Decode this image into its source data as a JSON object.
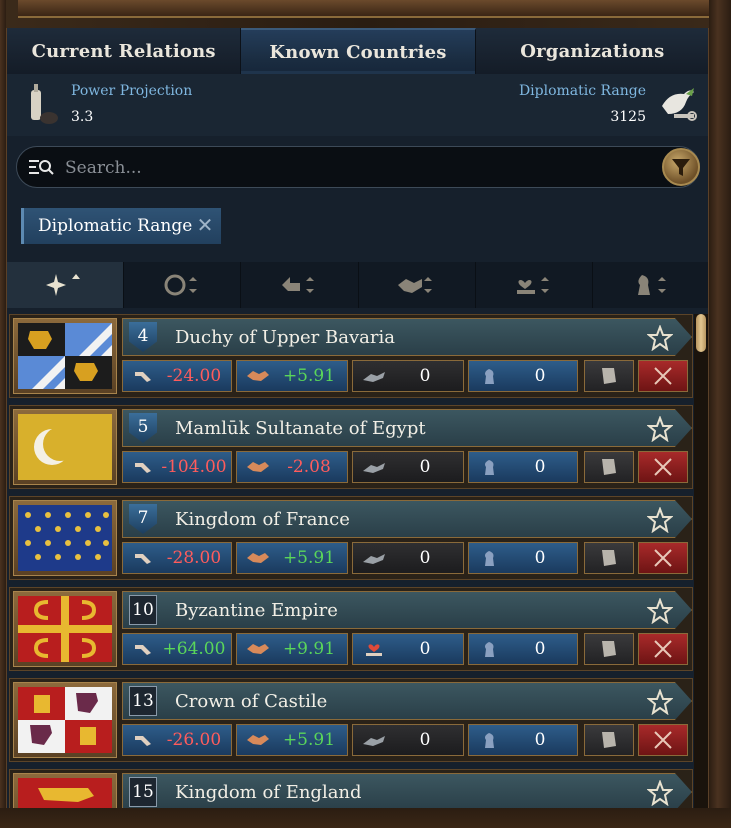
{
  "tabs": [
    {
      "label": "Current Relations",
      "active": false
    },
    {
      "label": "Known Countries",
      "active": true
    },
    {
      "label": "Organizations",
      "active": false
    }
  ],
  "stats": {
    "power_projection": {
      "label": "Power Projection",
      "value": "3.3"
    },
    "diplomatic_range": {
      "label": "Diplomatic Range",
      "value": "3125"
    }
  },
  "search": {
    "placeholder": "Search...",
    "value": ""
  },
  "active_filter": {
    "label": "Diplomatic Range"
  },
  "sort_columns": [
    "rank-sort",
    "culture-sort",
    "opinion-sort",
    "trust-sort",
    "favors-sort",
    "subject-sort"
  ],
  "colors": {
    "negative": "#ff5c5c",
    "positive": "#5ad65a",
    "accent": "#7fb7e0"
  },
  "countries": [
    {
      "rank": "4",
      "name": "Duchy of Upper Bavaria",
      "opinion": "-24.00",
      "trust": "+5.91",
      "favors": "0",
      "spies": "0",
      "rank_style": "shield"
    },
    {
      "rank": "5",
      "name": "Mamlūk Sultanate of Egypt",
      "opinion": "-104.00",
      "trust": "-2.08",
      "favors": "0",
      "spies": "0",
      "rank_style": "shield"
    },
    {
      "rank": "7",
      "name": "Kingdom of France",
      "opinion": "-28.00",
      "trust": "+5.91",
      "favors": "0",
      "spies": "0",
      "rank_style": "shield"
    },
    {
      "rank": "10",
      "name": "Byzantine Empire",
      "opinion": "+64.00",
      "trust": "+9.91",
      "favors": "0",
      "spies": "0",
      "rank_style": "box"
    },
    {
      "rank": "13",
      "name": "Crown of Castile",
      "opinion": "-26.00",
      "trust": "+5.91",
      "favors": "0",
      "spies": "0",
      "rank_style": "box"
    },
    {
      "rank": "15",
      "name": "Kingdom of England",
      "opinion": "",
      "trust": "",
      "favors": "",
      "spies": "",
      "rank_style": "box"
    }
  ]
}
